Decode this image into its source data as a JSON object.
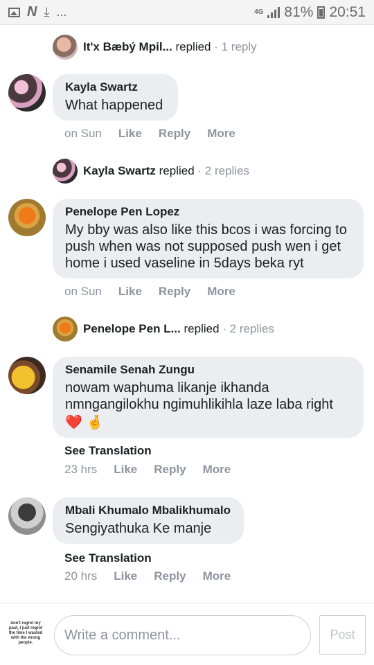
{
  "status_bar": {
    "network": "4G",
    "battery": "81%",
    "time": "20:51",
    "overflow": "..."
  },
  "reply_summaries": [
    {
      "name": "It'x Bæbý Mpil...",
      "verb": "replied",
      "count": "· 1 reply"
    },
    {
      "name": "Kayla Swartz",
      "verb": "replied",
      "count": "· 2 replies"
    },
    {
      "name": "Penelope Pen L...",
      "verb": "replied",
      "count": "· 2 replies"
    }
  ],
  "comments": [
    {
      "author": "Kayla Swartz",
      "text": "What happened",
      "time": "on Sun",
      "like": "Like",
      "reply": "Reply",
      "more": "More"
    },
    {
      "author": "Penelope Pen Lopez",
      "text": "My bby was also like this bcos i was forcing to push when was not supposed push wen i get home i used vaseline in 5days beka ryt",
      "time": "on Sun",
      "like": "Like",
      "reply": "Reply",
      "more": "More"
    },
    {
      "author": "Senamile Senah Zungu",
      "text": "nowam waphuma likanje ikhanda nmngangilokhu ngimuhlikihla laze laba right",
      "emoji": "❤️ 🤞",
      "see_translation": "See Translation",
      "time": "23 hrs",
      "like": "Like",
      "reply": "Reply",
      "more": "More"
    },
    {
      "author": "Mbali Khumalo Mbalikhumalo",
      "text": "Sengiyathuka Ke manje",
      "see_translation": "See Translation",
      "time": "20 hrs",
      "like": "Like",
      "reply": "Reply",
      "more": "More"
    }
  ],
  "composer": {
    "avatar_text": "don't regret my past, I just regret the time I wasted with the wrong people.",
    "placeholder": "Write a comment...",
    "post_label": "Post"
  }
}
